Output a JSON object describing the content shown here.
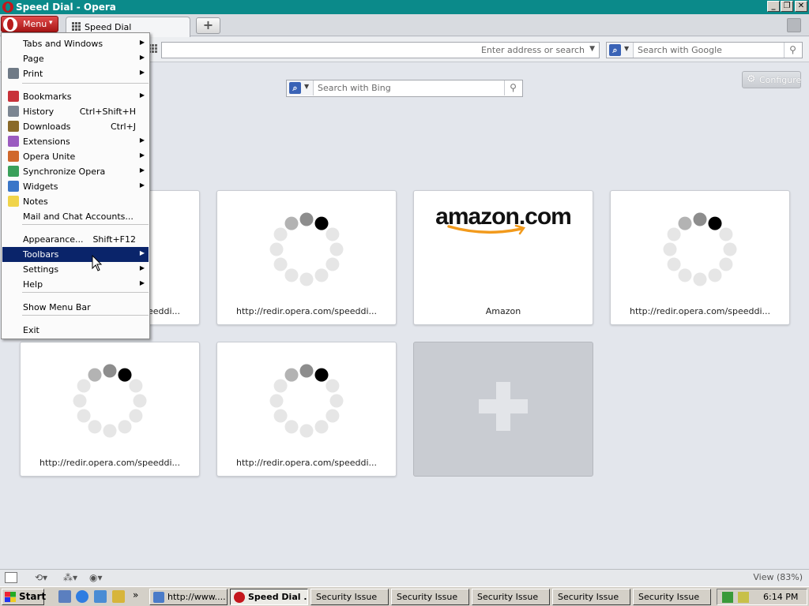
{
  "window": {
    "title": "Speed Dial - Opera"
  },
  "toolbar": {
    "menu_label": "Menu",
    "tab_label": "Speed Dial"
  },
  "addressbar": {
    "address_placeholder": "Enter address or search",
    "search_placeholder": "Search with Google"
  },
  "speed_dial": {
    "search_placeholder": "Search with Bing",
    "configure_label": "Configure",
    "dials": [
      {
        "caption": "http://redir.opera.com/speeddi..."
      },
      {
        "caption": "http://redir.opera.com/speeddi..."
      },
      {
        "caption": "Amazon",
        "logo": "amazon.com"
      },
      {
        "caption": "http://redir.opera.com/speeddi..."
      },
      {
        "caption": "http://redir.opera.com/speeddi..."
      },
      {
        "caption": "http://redir.opera.com/speeddi..."
      }
    ]
  },
  "menu": {
    "items": [
      {
        "label": "Tabs and Windows",
        "shortcut": "",
        "submenu": true,
        "icon": ""
      },
      {
        "label": "Page",
        "shortcut": "",
        "submenu": true,
        "icon": ""
      },
      {
        "label": "Print",
        "shortcut": "",
        "submenu": true,
        "icon": "printer-icon"
      },
      {
        "label": "Bookmarks",
        "shortcut": "",
        "submenu": true,
        "icon": "bookmarks-icon"
      },
      {
        "label": "History",
        "shortcut": "Ctrl+Shift+H",
        "submenu": false,
        "icon": "history-icon"
      },
      {
        "label": "Downloads",
        "shortcut": "Ctrl+J",
        "submenu": false,
        "icon": "downloads-icon"
      },
      {
        "label": "Extensions",
        "shortcut": "",
        "submenu": true,
        "icon": "extensions-icon"
      },
      {
        "label": "Opera Unite",
        "shortcut": "",
        "submenu": true,
        "icon": "unite-icon"
      },
      {
        "label": "Synchronize Opera",
        "shortcut": "",
        "submenu": true,
        "icon": "sync-icon"
      },
      {
        "label": "Widgets",
        "shortcut": "",
        "submenu": true,
        "icon": "widgets-icon"
      },
      {
        "label": "Notes",
        "shortcut": "",
        "submenu": false,
        "icon": "notes-icon"
      },
      {
        "label": "Mail and Chat Accounts...",
        "shortcut": "",
        "submenu": false,
        "icon": ""
      },
      {
        "label": "Appearance...",
        "shortcut": "Shift+F12",
        "submenu": false,
        "icon": ""
      },
      {
        "label": "Toolbars",
        "shortcut": "",
        "submenu": true,
        "icon": "",
        "highlighted": true
      },
      {
        "label": "Settings",
        "shortcut": "",
        "submenu": true,
        "icon": ""
      },
      {
        "label": "Help",
        "shortcut": "",
        "submenu": true,
        "icon": ""
      },
      {
        "label": "Show Menu Bar",
        "shortcut": "",
        "submenu": false,
        "icon": ""
      },
      {
        "label": "Exit",
        "shortcut": "",
        "submenu": false,
        "icon": ""
      }
    ]
  },
  "statusbar": {
    "zoom_label": "View (83%)"
  },
  "taskbar": {
    "start_label": "Start",
    "tasks": [
      {
        "label": "http://www....",
        "active": false
      },
      {
        "label": "Speed Dial ...",
        "active": true
      },
      {
        "label": "Security Issue",
        "active": false
      },
      {
        "label": "Security Issue",
        "active": false
      },
      {
        "label": "Security Issue",
        "active": false
      },
      {
        "label": "Security Issue",
        "active": false
      },
      {
        "label": "Security Issue",
        "active": false
      }
    ],
    "clock": "6:14 PM",
    "overflow": "»"
  },
  "colors": {
    "title_bar": "#0b8a8a",
    "menu_highlight": "#0a246a",
    "opera_red": "#c4161c"
  }
}
